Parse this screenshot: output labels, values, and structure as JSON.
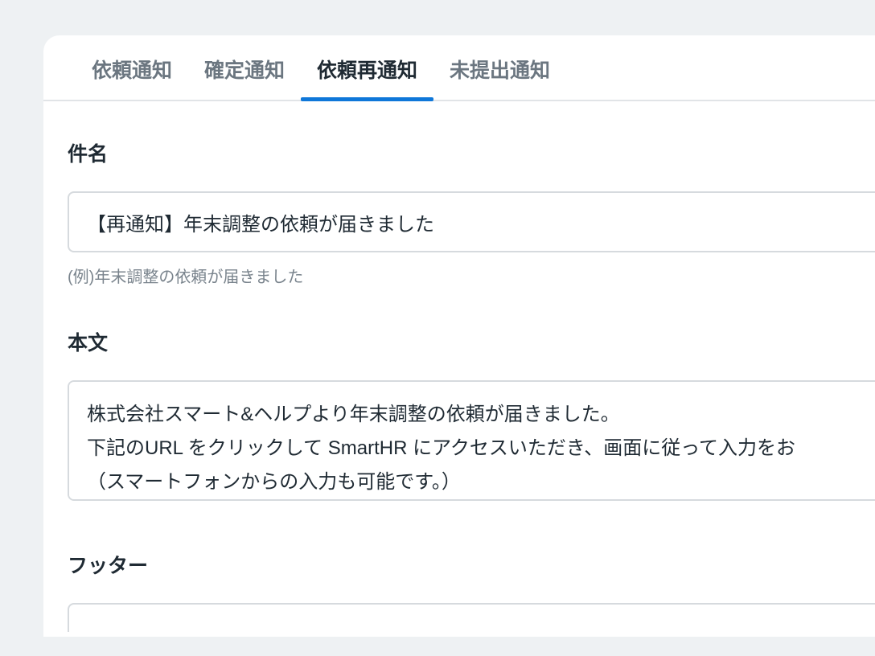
{
  "tabs": [
    {
      "label": "依頼通知",
      "active": false
    },
    {
      "label": "確定通知",
      "active": false
    },
    {
      "label": "依頼再通知",
      "active": true
    },
    {
      "label": "未提出通知",
      "active": false
    }
  ],
  "sections": {
    "subject": {
      "label": "件名",
      "value": "【再通知】年末調整の依頼が届きました",
      "hint": "(例)年末調整の依頼が届きました"
    },
    "body": {
      "label": "本文",
      "value": "株式会社スマート&ヘルプより年末調整の依頼が届きました。\n下記のURL をクリックして SmartHR にアクセスいただき、画面に従って入力をお\n（スマートフォンからの入力も可能です。）"
    },
    "footer": {
      "label": "フッター",
      "value": ""
    }
  }
}
